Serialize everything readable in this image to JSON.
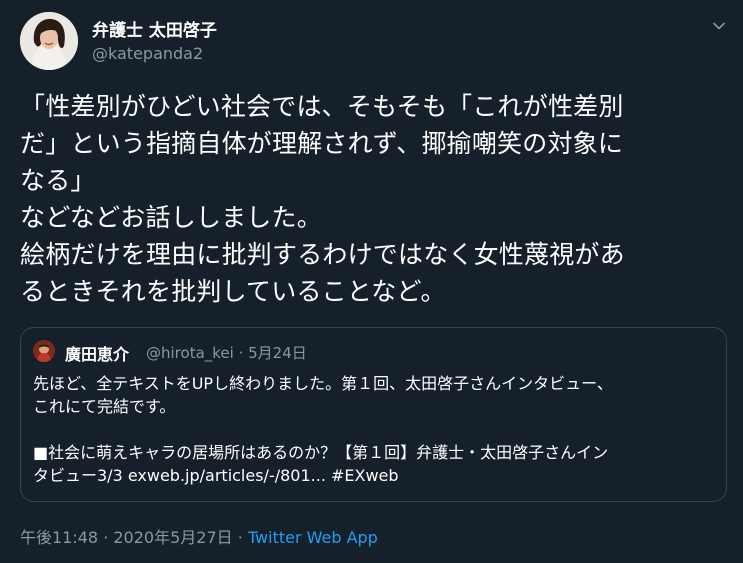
{
  "tweet": {
    "author_name": "弁護士 太田啓子",
    "author_handle": "@katepanda2",
    "text_lines": [
      "「性差別がひどい社会では、そもそも「これが性差別",
      "だ」という指摘自体が理解されず、揶揄嘲笑の対象に",
      "なる」",
      "などなどお話ししました。",
      "絵柄だけを理由に批判するわけではなく女性蔑視があ",
      "るときそれを批判していることなど。"
    ],
    "timestamp": "午後11:48 · 2020年5月27日 · ",
    "source_app": "Twitter Web App"
  },
  "quoted_tweet": {
    "author_name": "廣田恵介",
    "author_handle": "@hirota_kei",
    "separator": " · ",
    "date": "5月24日",
    "text_lines": [
      "先ほど、全テキストをUPし終わりました。第１回、太田啓子さんインタビュー、",
      "これにて完結です。",
      "",
      "■社会に萌えキャラの居場所はあるのか？【第１回】弁護士・太田啓子さんイン",
      "タビュー3/3 exweb.jp/articles/-/801... #EXweb"
    ]
  },
  "icons": {
    "author_avatar": "avatar",
    "more_menu": "chevron-down-icon",
    "quoted_author_avatar": "avatar"
  },
  "colors": {
    "background": "#15202b",
    "text_primary": "#ffffff",
    "text_secondary": "#8899a6",
    "link": "#1da1f2",
    "border": "#38444d"
  }
}
